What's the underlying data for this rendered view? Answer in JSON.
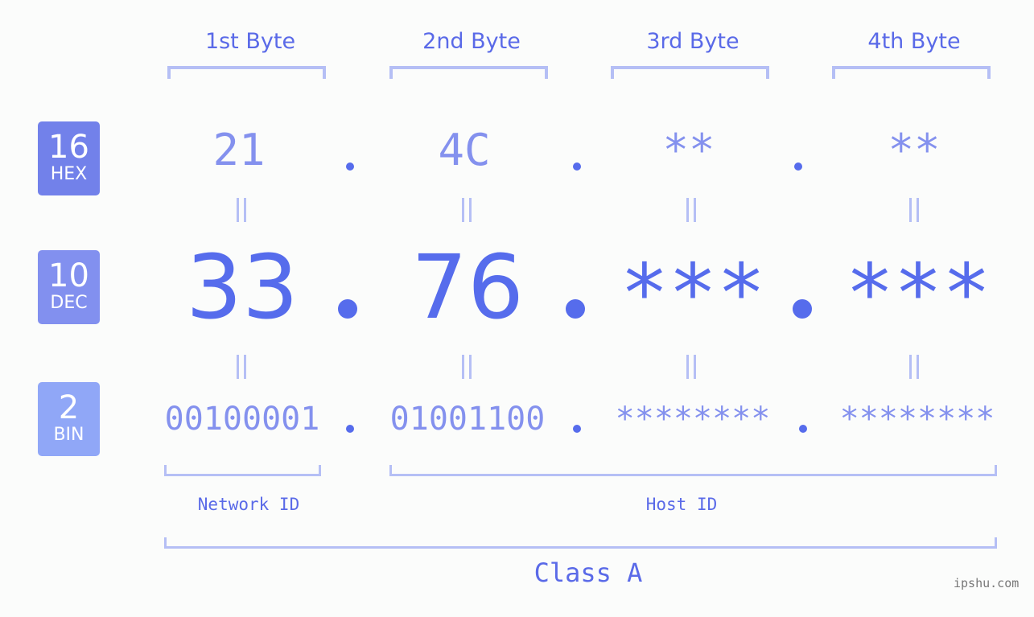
{
  "badges": [
    {
      "base": "16",
      "label": "HEX",
      "color": "#7281ea"
    },
    {
      "base": "10",
      "label": "DEC",
      "color": "#8290ef"
    },
    {
      "base": "2",
      "label": "BIN",
      "color": "#90a7f7"
    }
  ],
  "bytes": [
    {
      "header": "1st Byte",
      "hex": "21",
      "dec": "33",
      "bin": "00100001"
    },
    {
      "header": "2nd Byte",
      "hex": "4C",
      "dec": "76",
      "bin": "01001100"
    },
    {
      "header": "3rd Byte",
      "hex": "**",
      "dec": "***",
      "bin": "********"
    },
    {
      "header": "4th Byte",
      "hex": "**",
      "dec": "***",
      "bin": "********"
    }
  ],
  "separator": ".",
  "equals_symbol": "=",
  "network_id_label": "Network ID",
  "host_id_label": "Host ID",
  "class_label": "Class A",
  "watermark": "ipshu.com",
  "colors": {
    "accent": "#566cec",
    "light_text": "#8491ee",
    "bracket": "#b5bff5",
    "background": "#fbfcfb"
  }
}
